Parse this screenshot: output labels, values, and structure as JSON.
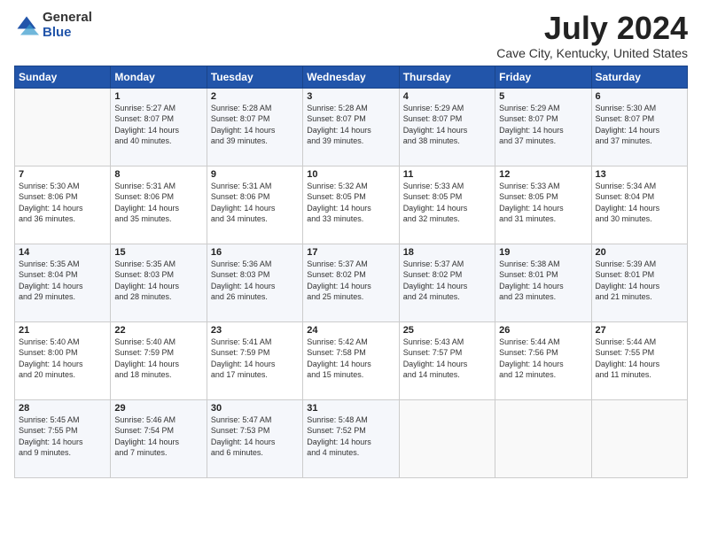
{
  "logo": {
    "general": "General",
    "blue": "Blue"
  },
  "title": "July 2024",
  "subtitle": "Cave City, Kentucky, United States",
  "headers": [
    "Sunday",
    "Monday",
    "Tuesday",
    "Wednesday",
    "Thursday",
    "Friday",
    "Saturday"
  ],
  "weeks": [
    [
      {
        "day": "",
        "info": ""
      },
      {
        "day": "1",
        "info": "Sunrise: 5:27 AM\nSunset: 8:07 PM\nDaylight: 14 hours\nand 40 minutes."
      },
      {
        "day": "2",
        "info": "Sunrise: 5:28 AM\nSunset: 8:07 PM\nDaylight: 14 hours\nand 39 minutes."
      },
      {
        "day": "3",
        "info": "Sunrise: 5:28 AM\nSunset: 8:07 PM\nDaylight: 14 hours\nand 39 minutes."
      },
      {
        "day": "4",
        "info": "Sunrise: 5:29 AM\nSunset: 8:07 PM\nDaylight: 14 hours\nand 38 minutes."
      },
      {
        "day": "5",
        "info": "Sunrise: 5:29 AM\nSunset: 8:07 PM\nDaylight: 14 hours\nand 37 minutes."
      },
      {
        "day": "6",
        "info": "Sunrise: 5:30 AM\nSunset: 8:07 PM\nDaylight: 14 hours\nand 37 minutes."
      }
    ],
    [
      {
        "day": "7",
        "info": "Sunrise: 5:30 AM\nSunset: 8:06 PM\nDaylight: 14 hours\nand 36 minutes."
      },
      {
        "day": "8",
        "info": "Sunrise: 5:31 AM\nSunset: 8:06 PM\nDaylight: 14 hours\nand 35 minutes."
      },
      {
        "day": "9",
        "info": "Sunrise: 5:31 AM\nSunset: 8:06 PM\nDaylight: 14 hours\nand 34 minutes."
      },
      {
        "day": "10",
        "info": "Sunrise: 5:32 AM\nSunset: 8:05 PM\nDaylight: 14 hours\nand 33 minutes."
      },
      {
        "day": "11",
        "info": "Sunrise: 5:33 AM\nSunset: 8:05 PM\nDaylight: 14 hours\nand 32 minutes."
      },
      {
        "day": "12",
        "info": "Sunrise: 5:33 AM\nSunset: 8:05 PM\nDaylight: 14 hours\nand 31 minutes."
      },
      {
        "day": "13",
        "info": "Sunrise: 5:34 AM\nSunset: 8:04 PM\nDaylight: 14 hours\nand 30 minutes."
      }
    ],
    [
      {
        "day": "14",
        "info": "Sunrise: 5:35 AM\nSunset: 8:04 PM\nDaylight: 14 hours\nand 29 minutes."
      },
      {
        "day": "15",
        "info": "Sunrise: 5:35 AM\nSunset: 8:03 PM\nDaylight: 14 hours\nand 28 minutes."
      },
      {
        "day": "16",
        "info": "Sunrise: 5:36 AM\nSunset: 8:03 PM\nDaylight: 14 hours\nand 26 minutes."
      },
      {
        "day": "17",
        "info": "Sunrise: 5:37 AM\nSunset: 8:02 PM\nDaylight: 14 hours\nand 25 minutes."
      },
      {
        "day": "18",
        "info": "Sunrise: 5:37 AM\nSunset: 8:02 PM\nDaylight: 14 hours\nand 24 minutes."
      },
      {
        "day": "19",
        "info": "Sunrise: 5:38 AM\nSunset: 8:01 PM\nDaylight: 14 hours\nand 23 minutes."
      },
      {
        "day": "20",
        "info": "Sunrise: 5:39 AM\nSunset: 8:01 PM\nDaylight: 14 hours\nand 21 minutes."
      }
    ],
    [
      {
        "day": "21",
        "info": "Sunrise: 5:40 AM\nSunset: 8:00 PM\nDaylight: 14 hours\nand 20 minutes."
      },
      {
        "day": "22",
        "info": "Sunrise: 5:40 AM\nSunset: 7:59 PM\nDaylight: 14 hours\nand 18 minutes."
      },
      {
        "day": "23",
        "info": "Sunrise: 5:41 AM\nSunset: 7:59 PM\nDaylight: 14 hours\nand 17 minutes."
      },
      {
        "day": "24",
        "info": "Sunrise: 5:42 AM\nSunset: 7:58 PM\nDaylight: 14 hours\nand 15 minutes."
      },
      {
        "day": "25",
        "info": "Sunrise: 5:43 AM\nSunset: 7:57 PM\nDaylight: 14 hours\nand 14 minutes."
      },
      {
        "day": "26",
        "info": "Sunrise: 5:44 AM\nSunset: 7:56 PM\nDaylight: 14 hours\nand 12 minutes."
      },
      {
        "day": "27",
        "info": "Sunrise: 5:44 AM\nSunset: 7:55 PM\nDaylight: 14 hours\nand 11 minutes."
      }
    ],
    [
      {
        "day": "28",
        "info": "Sunrise: 5:45 AM\nSunset: 7:55 PM\nDaylight: 14 hours\nand 9 minutes."
      },
      {
        "day": "29",
        "info": "Sunrise: 5:46 AM\nSunset: 7:54 PM\nDaylight: 14 hours\nand 7 minutes."
      },
      {
        "day": "30",
        "info": "Sunrise: 5:47 AM\nSunset: 7:53 PM\nDaylight: 14 hours\nand 6 minutes."
      },
      {
        "day": "31",
        "info": "Sunrise: 5:48 AM\nSunset: 7:52 PM\nDaylight: 14 hours\nand 4 minutes."
      },
      {
        "day": "",
        "info": ""
      },
      {
        "day": "",
        "info": ""
      },
      {
        "day": "",
        "info": ""
      }
    ]
  ]
}
